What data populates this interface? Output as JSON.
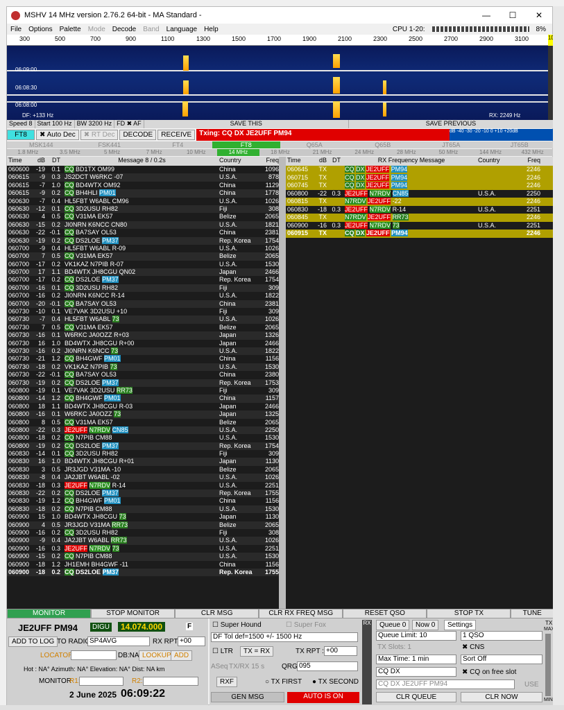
{
  "window": {
    "title": "MSHV 14 MHz version 2.76.2 64-bit  - MA Standard -",
    "min": "—",
    "max": "☐",
    "close": "✕"
  },
  "menu": [
    "File",
    "Options",
    "Palette",
    "Mode",
    "Decode",
    "Band",
    "Language",
    "Help"
  ],
  "cpu": {
    "label": "CPU 1-20:",
    "pct": "8%"
  },
  "ruler": [
    "300",
    "500",
    "700",
    "900",
    "1100",
    "1300",
    "1500",
    "1700",
    "1900",
    "2100",
    "2300",
    "2500",
    "2700",
    "2900",
    "3100"
  ],
  "wf": {
    "times": [
      "06:09:00",
      "06:08:30",
      "06:08:00"
    ],
    "df": "DF: +133 Hz",
    "rx": "RX: 2249 Hz"
  },
  "ctrl": {
    "speed": "Speed 8",
    "start": "Start 100 Hz",
    "bw": "BW 3200 Hz",
    "fd": "FD ✖ AF",
    "save": "SAVE THIS",
    "saveprev": "SAVE PREVIOUS"
  },
  "mode": {
    "ft8": "FT8",
    "autodec": "✖ Auto Dec",
    "rtdec": "✖ RT Dec",
    "decode": "DECODE",
    "receive": "RECEIVE",
    "txing": "Txing: CQ DX JE2UFF PM94",
    "scale": "dB -40 -30 -20 -10 0 +10 +20dB"
  },
  "modes": [
    "MSK144",
    "FSK441",
    "FT4",
    "FT8",
    "Q65A",
    "Q65B",
    "JT65A",
    "JT65B"
  ],
  "bands": [
    "1.8 MHz",
    "3.5 MHz",
    "5 MHz",
    "7 MHz",
    "10 MHz",
    "14 MHz",
    "18 MHz",
    "21 MHz",
    "24 MHz",
    "28 MHz",
    "50 MHz",
    "144 MHz",
    "432 MHz"
  ],
  "left": {
    "hdr": [
      "Time",
      "dB",
      "DT",
      "Message 8 / 0.2s",
      "Country",
      "Freq"
    ],
    "rows": [
      [
        "060600",
        "-19",
        "0.1",
        "CQ BD1TX OM99",
        "China",
        "1096"
      ],
      [
        "060615",
        "-9",
        "0.3",
        "JS2DCT W6RKC -07",
        "U.S.A.",
        "878"
      ],
      [
        "060615",
        "-7",
        "1.0",
        "CQ BD4WTX OM92",
        "China",
        "1129"
      ],
      [
        "060615",
        "-9",
        "0.2",
        "CQ BH4HLI PM01",
        "China",
        "1778"
      ],
      [
        "060630",
        "-7",
        "0.4",
        "HL5FBT W6ABL CM96",
        "U.S.A.",
        "1026"
      ],
      [
        "060630",
        "-12",
        "0.1",
        "CQ 3D2USU RH82",
        "Fiji",
        "308"
      ],
      [
        "060630",
        "4",
        "0.5",
        "CQ V31MA EK57",
        "Belize",
        "2065"
      ],
      [
        "060630",
        "-15",
        "0.2",
        "JI0NRN K6NCC CN80",
        "U.S.A.",
        "1821"
      ],
      [
        "060630",
        "-22",
        "-0.1",
        "CQ BA7SAY OL53",
        "China",
        "2381"
      ],
      [
        "060630",
        "-19",
        "0.2",
        "CQ DS2LOE PM37",
        "Rep. Korea",
        "1754"
      ],
      [
        "060700",
        "-9",
        "0.4",
        "HL5FBT W6ABL R-09",
        "U.S.A.",
        "1026"
      ],
      [
        "060700",
        "7",
        "0.5",
        "CQ V31MA EK57",
        "Belize",
        "2065"
      ],
      [
        "060700",
        "-17",
        "0.2",
        "VK1KAZ N7PIB R-07",
        "U.S.A.",
        "1530"
      ],
      [
        "060700",
        "17",
        "1.1",
        "BD4WTX JH8CGU QN02",
        "Japan",
        "2466"
      ],
      [
        "060700",
        "-17",
        "0.2",
        "CQ DS2LOE PM37",
        "Rep. Korea",
        "1754"
      ],
      [
        "060700",
        "-16",
        "0.1",
        "CQ 3D2USU RH82",
        "Fiji",
        "309"
      ],
      [
        "060700",
        "-16",
        "0.2",
        "JI0NRN K6NCC R-14",
        "U.S.A.",
        "1822"
      ],
      [
        "060700",
        "-20",
        "-0.1",
        "CQ BA7SAY OL53",
        "China",
        "2381"
      ],
      [
        "060730",
        "-10",
        "0.1",
        "VE7VAK 3D2USU +10",
        "Fiji",
        "309"
      ],
      [
        "060730",
        "-7",
        "0.4",
        "HL5FBT W6ABL 73",
        "U.S.A.",
        "1026"
      ],
      [
        "060730",
        "7",
        "0.5",
        "CQ V31MA EK57",
        "Belize",
        "2065"
      ],
      [
        "060730",
        "-16",
        "0.1",
        "W6RKC JA0OZZ R+03",
        "Japan",
        "1326"
      ],
      [
        "060730",
        "16",
        "1.0",
        "BD4WTX JH8CGU R+00",
        "Japan",
        "2466"
      ],
      [
        "060730",
        "-16",
        "0.2",
        "JI0NRN K6NCC 73",
        "U.S.A.",
        "1822"
      ],
      [
        "060730",
        "-21",
        "1.2",
        "CQ BH4GWF PM01",
        "China",
        "1156"
      ],
      [
        "060730",
        "-18",
        "0.2",
        "VK1KAZ N7PIB 73",
        "U.S.A.",
        "1530"
      ],
      [
        "060730",
        "-22",
        "-0.1",
        "CQ BA7SAY OL53",
        "China",
        "2380"
      ],
      [
        "060730",
        "-19",
        "0.2",
        "CQ DS2LOE PM37",
        "Rep. Korea",
        "1753"
      ],
      [
        "060800",
        "-19",
        "0.1",
        "VE7VAK 3D2USU RR73",
        "Fiji",
        "309"
      ],
      [
        "060800",
        "-14",
        "1.2",
        "CQ BH4GWF PM01",
        "China",
        "1157"
      ],
      [
        "060800",
        "18",
        "1.1",
        "BD4WTX JH8CGU R-03",
        "Japan",
        "2466"
      ],
      [
        "060800",
        "-16",
        "0.1",
        "W6RKC JA0OZZ 73",
        "Japan",
        "1325"
      ],
      [
        "060800",
        "8",
        "0.5",
        "CQ V31MA EK57",
        "Belize",
        "2065"
      ],
      [
        "060800",
        "-22",
        "0.3",
        "JE2UFF N7RDV CN85",
        "U.S.A.",
        "2250"
      ],
      [
        "060800",
        "-18",
        "0.2",
        "CQ N7PIB CM88",
        "U.S.A.",
        "1530"
      ],
      [
        "060800",
        "-19",
        "0.2",
        "CQ DS2LOE PM37",
        "Rep. Korea",
        "1754"
      ],
      [
        "060830",
        "-14",
        "0.1",
        "CQ 3D2USU RH82",
        "Fiji",
        "309"
      ],
      [
        "060830",
        "16",
        "1.0",
        "BD4WTX JH8CGU R+01",
        "Japan",
        "1130"
      ],
      [
        "060830",
        "3",
        "0.5",
        "JR3JGD V31MA -10",
        "Belize",
        "2065"
      ],
      [
        "060830",
        "-8",
        "0.4",
        "JA2JBT W6ABL -02",
        "U.S.A.",
        "1026"
      ],
      [
        "060830",
        "-18",
        "0.3",
        "JE2UFF N7RDV R-14",
        "U.S.A.",
        "2251"
      ],
      [
        "060830",
        "-22",
        "0.2",
        "CQ DS2LOE PM37",
        "Rep. Korea",
        "1755"
      ],
      [
        "060830",
        "-19",
        "1.2",
        "CQ BH4GWF PM01",
        "China",
        "1156"
      ],
      [
        "060830",
        "-18",
        "0.2",
        "CQ N7PIB CM88",
        "U.S.A.",
        "1530"
      ],
      [
        "060900",
        "15",
        "1.0",
        "BD4WTX JH8CGU 73",
        "Japan",
        "1130"
      ],
      [
        "060900",
        "4",
        "0.5",
        "JR3JGD V31MA RR73",
        "Belize",
        "2065"
      ],
      [
        "060900",
        "-16",
        "0.2",
        "CQ 3D2USU RH82",
        "Fiji",
        "308"
      ],
      [
        "060900",
        "-9",
        "0.4",
        "JA2JBT W6ABL RR73",
        "U.S.A.",
        "1026"
      ],
      [
        "060900",
        "-16",
        "0.3",
        "JE2UFF N7RDV 73",
        "U.S.A.",
        "2251"
      ],
      [
        "060900",
        "-15",
        "0.2",
        "CQ N7PIB CM88",
        "U.S.A.",
        "1530"
      ],
      [
        "060900",
        "-18",
        "1.2",
        "JH1EMH BH4GWF -11",
        "China",
        "1156"
      ],
      [
        "060900",
        "-18",
        "0.2",
        "CQ DS2LOE PM37",
        "Rep. Korea",
        "1755"
      ]
    ]
  },
  "right": {
    "hdr": [
      "Time",
      "dB",
      "DT",
      "RX Frequency Message",
      "Country",
      "Freq"
    ],
    "rows": [
      [
        "060645",
        "TX",
        "",
        "CQ DX JE2UFF PM94",
        "",
        "2246"
      ],
      [
        "060715",
        "TX",
        "",
        "CQ DX JE2UFF PM94",
        "",
        "2246"
      ],
      [
        "060745",
        "TX",
        "",
        "CQ DX JE2UFF PM94",
        "",
        "2246"
      ],
      [
        "060800",
        "-22",
        "0.3",
        "JE2UFF N7RDV CN85",
        "U.S.A.",
        "2250"
      ],
      [
        "060815",
        "TX",
        "",
        "N7RDV JE2UFF -22",
        "",
        "2246"
      ],
      [
        "060830",
        "-18",
        "0.3",
        "JE2UFF N7RDV R-14",
        "U.S.A.",
        "2251"
      ],
      [
        "060845",
        "TX",
        "",
        "N7RDV JE2UFF RR73",
        "",
        "2246"
      ],
      [
        "060900",
        "-16",
        "0.3",
        "JE2UFF N7RDV 73",
        "U.S.A.",
        "2251"
      ],
      [
        "060915",
        "TX",
        "",
        "CQ DX JE2UFF PM94",
        "",
        "2246"
      ]
    ]
  },
  "buttons": [
    "MONITOR",
    "STOP MONITOR",
    "CLR MSG",
    "CLR RX FREQ MSG",
    "RESET QSO",
    "STOP TX",
    "TUNE"
  ],
  "station": {
    "call": "JE2UFF PM94",
    "mode": "DIGU",
    "freq": "14.074.000",
    "f": "F",
    "addlog": "ADD TO LOG",
    "toradio": "TO RADIO:",
    "toradio_val": "SP4AVG",
    "rxrpt": "RX RPT:",
    "rxrpt_val": "+00",
    "locator": "LOCATOR",
    "db": "DB:NA",
    "lookup": "LOOKUP",
    "add": "ADD",
    "info": "Hot : NA°  Azimuth: NA°  Elevation: NA°  Dist: NA km",
    "monitor": "MONITOR",
    "r1": "R1:",
    "r2": "R2:",
    "date": "2 June 2025",
    "time": "06:09:22"
  },
  "mid": {
    "superhound": "Super Hound",
    "superfox": "Super Fox",
    "dftol": "DF Tol def=1500 +/-  1500  Hz",
    "ltr": "LTR",
    "txrx": "TX = RX",
    "txrpt": "TX RPT :",
    "txrpt_val": "+00",
    "aseq": "ASeq",
    "txrx15": "TX/RX 15 s",
    "qrg": "QRG:",
    "qrg_val": "095",
    "rxf": "RXF",
    "txfirst": "TX FIRST",
    "txsecond": "TX SECOND",
    "genmsg": "GEN MSG",
    "autoon": "AUTO IS ON"
  },
  "queue": {
    "rx": "RX",
    "tabs": [
      "Queue 0",
      "Now 0",
      "Settings"
    ],
    "limit": "Queue Limit: 10",
    "txslots": "TX Slots: 1",
    "maxtime": "Max Time: 1 min",
    "cqdx": "CQ DX",
    "cqmsg": "CQ DX JE2UFF PM94",
    "use": "USE",
    "qso": "1 QSO",
    "cns": "CNS",
    "sort": "Sort Off",
    "cqfree": "CQ on free slot",
    "clrqueue": "CLR QUEUE",
    "clrnow": "CLR NOW",
    "tx": "TX",
    "max": "MAX",
    "min": "MIN"
  }
}
